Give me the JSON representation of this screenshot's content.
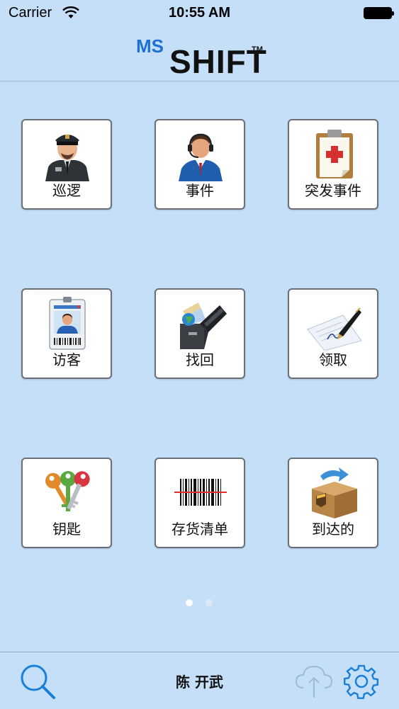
{
  "status_bar": {
    "carrier": "Carrier",
    "time": "10:55 AM"
  },
  "header": {
    "logo_ms": "MS",
    "logo_shift": "SHIFT",
    "logo_tm": "TM"
  },
  "tiles": [
    {
      "label": "巡逻",
      "icon": "security-guard-icon"
    },
    {
      "label": "事件",
      "icon": "operator-headset-icon"
    },
    {
      "label": "突发事件",
      "icon": "clipboard-medical-icon"
    },
    {
      "label": "访客",
      "icon": "visitor-badge-icon"
    },
    {
      "label": "找回",
      "icon": "lost-and-found-box-icon"
    },
    {
      "label": "领取",
      "icon": "pen-signature-icon"
    },
    {
      "label": "钥匙",
      "icon": "keys-icon"
    },
    {
      "label": "存货清单",
      "icon": "barcode-icon"
    },
    {
      "label": "到达的",
      "icon": "package-arrival-icon"
    }
  ],
  "pagination": {
    "pages": 2,
    "current": 1
  },
  "bottom_bar": {
    "user_name": "陈 开武",
    "search_icon": "search-icon",
    "cloud_icon": "cloud-upload-icon",
    "settings_icon": "gear-icon"
  },
  "colors": {
    "background": "#c4dff7",
    "accent": "#1a7fd6",
    "logo_blue": "#1e6fd1"
  }
}
